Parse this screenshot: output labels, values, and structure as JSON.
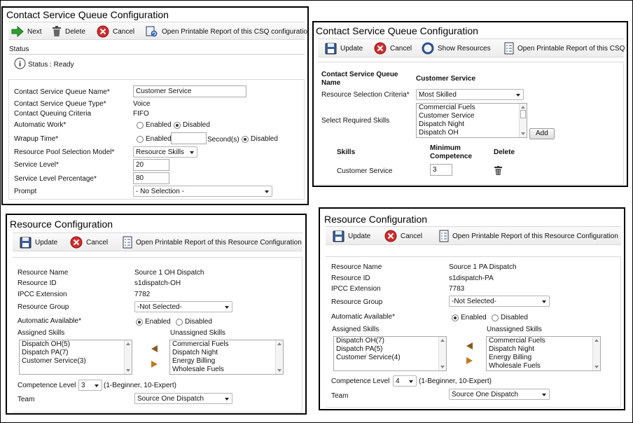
{
  "csq1": {
    "title": "Contact Service Queue Configuration",
    "toolbar": {
      "next": "Next",
      "delete": "Delete",
      "cancel": "Cancel",
      "report": "Open Printable Report of this CSQ configuration"
    },
    "status_heading": "Status",
    "status_text": "Status : Ready",
    "fields": {
      "name_label": "Contact Service Queue Name*",
      "name_value": "Customer Service",
      "type_label": "Contact Service Queue Type*",
      "type_value": "Voice",
      "criteria_label": "Contact Queuing Criteria",
      "criteria_value": "FIFO",
      "auto_work_label": "Automatic Work*",
      "auto_work_enabled": "Enabled",
      "auto_work_disabled": "Disabled",
      "wrapup_label": "Wrapup Time*",
      "wrapup_enabled": "Enabled",
      "wrapup_seconds": "Second(s)",
      "wrapup_disabled": "Disabled",
      "pool_label": "Resource Pool Selection Model*",
      "pool_value": "Resource Skills",
      "service_level_label": "Service Level*",
      "service_level_value": "20",
      "service_pct_label": "Service Level Percentage*",
      "service_pct_value": "80",
      "prompt_label": "Prompt",
      "prompt_value": "- No Selection -"
    }
  },
  "csq2": {
    "title": "Contact Service Queue Configuration",
    "toolbar": {
      "update": "Update",
      "cancel": "Cancel",
      "show": "Show Resources",
      "report": "Open Printable Report of this CSQ"
    },
    "name_label": "Contact Service Queue Name",
    "name_value": "Customer Service",
    "criteria_label": "Resource Selection Criteria*",
    "criteria_value": "Most Skilled",
    "skills_label": "Select Required Skills",
    "skills_options": [
      "Commercial Fuels",
      "Customer Service",
      "Dispatch Night",
      "Dispatch OH"
    ],
    "add_label": "Add",
    "table_headers": {
      "skills": "Skills",
      "min_comp_1": "Minimum",
      "min_comp_2": "Competence",
      "delete": "Delete"
    },
    "row": {
      "skill": "Customer Service",
      "competence": "3"
    }
  },
  "res1": {
    "title": "Resource Configuration",
    "toolbar": {
      "update": "Update",
      "cancel": "Cancel",
      "report": "Open Printable Report of this Resource Configuration"
    },
    "name_label": "Resource Name",
    "name_value": "Source 1 OH Dispatch",
    "id_label": "Resource ID",
    "id_value": "s1dispatch-OH",
    "ext_label": "IPCC Extension",
    "ext_value": "7782",
    "group_label": "Resource Group",
    "group_value": "-Not Selected-",
    "auto_label": "Automatic Available*",
    "auto_enabled": "Enabled",
    "auto_disabled": "Disabled",
    "assigned_label": "Assigned Skills",
    "assigned": [
      "Dispatch OH(5)",
      "Dispatch PA(7)",
      "Customer Service(3)"
    ],
    "unassigned_label": "Unassigned Skills",
    "unassigned": [
      "Commercial Fuels",
      "Dispatch Night",
      "Energy Billing",
      "Wholesale Fuels"
    ],
    "competence_label": "Competence Level",
    "competence_value": "3",
    "competence_hint": "(1-Beginner, 10-Expert)",
    "team_label": "Team",
    "team_value": "Source One Dispatch"
  },
  "res2": {
    "title": "Resource Configuration",
    "toolbar": {
      "update": "Update",
      "cancel": "Cancel",
      "report": "Open Printable Report of this Resource Configuration"
    },
    "name_label": "Resource Name",
    "name_value": "Source 1 PA Dispatch",
    "id_label": "Resource ID",
    "id_value": "s1dispatch-PA",
    "ext_label": "IPCC Extension",
    "ext_value": "7783",
    "group_label": "Resource Group",
    "group_value": "-Not Selected-",
    "auto_label": "Automatic Available*",
    "auto_enabled": "Enabled",
    "auto_disabled": "Disabled",
    "assigned_label": "Assigned Skills",
    "assigned": [
      "Dispatch OH(7)",
      "Dispatch PA(5)",
      "Customer Service(4)"
    ],
    "unassigned_label": "Unassigned Skills",
    "unassigned": [
      "Commercial Fuels",
      "Dispatch Night",
      "Energy Billing",
      "Wholesale Fuels"
    ],
    "competence_label": "Competence Level",
    "competence_value": "4",
    "competence_hint": "(1-Beginner, 10-Expert)",
    "team_label": "Team",
    "team_value": "Source One Dispatch"
  },
  "colors": {
    "cancel_red": "#d22c2c",
    "next_green": "#2e9e2e",
    "arrow_brown": "#8b5a1a",
    "border": "#000000"
  }
}
